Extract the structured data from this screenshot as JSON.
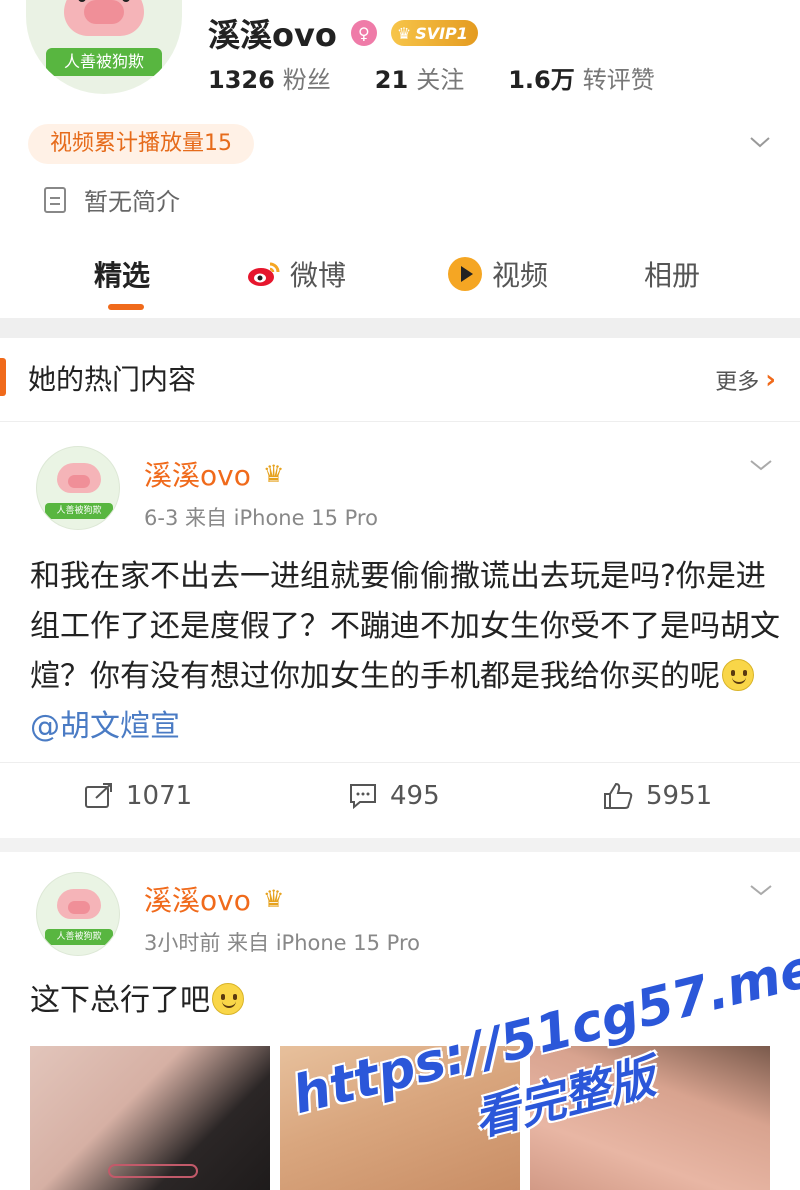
{
  "profile": {
    "name": "溪溪ovo",
    "avatar_tag": "人善被狗欺",
    "vip_label": "SVIP1",
    "stats": [
      {
        "num": "1326",
        "label": "粉丝"
      },
      {
        "num": "21",
        "label": "关注"
      },
      {
        "num": "1.6万",
        "label": "转评赞"
      }
    ],
    "play_badge": "视频累计播放量15",
    "intro": "暂无简介"
  },
  "tabs": [
    {
      "label": "精选"
    },
    {
      "label": "微博",
      "icon": "weibo-icon"
    },
    {
      "label": "视频",
      "icon": "video-icon"
    },
    {
      "label": "相册"
    }
  ],
  "hot": {
    "title": "她的热门内容",
    "more_label": "更多"
  },
  "posts": [
    {
      "author": "溪溪ovo",
      "avatar_tag": "人善被狗欺",
      "meta": "6-3  来自 iPhone 15 Pro",
      "text": "和我在家不出去一进组就要偷偷撒谎出去玩是吗?你是进组工作了还是度假了？不蹦迪不加女生你受不了是吗胡文煊？你有没有想过你加女生的手机都是我给你买的呢",
      "mention": "@胡文煊宣",
      "reposts": "1071",
      "comments": "495",
      "likes": "5951"
    },
    {
      "author": "溪溪ovo",
      "avatar_tag": "人善被狗欺",
      "meta": "3小时前  来自 iPhone 15 Pro",
      "text": "这下总行了吧"
    }
  ],
  "watermark": {
    "url": "https://51cg57.me",
    "sub": "看完整版"
  },
  "colors": {
    "accent": "#f06a1b",
    "mention": "#4a7bc4",
    "watermark": "#2b57d9"
  }
}
